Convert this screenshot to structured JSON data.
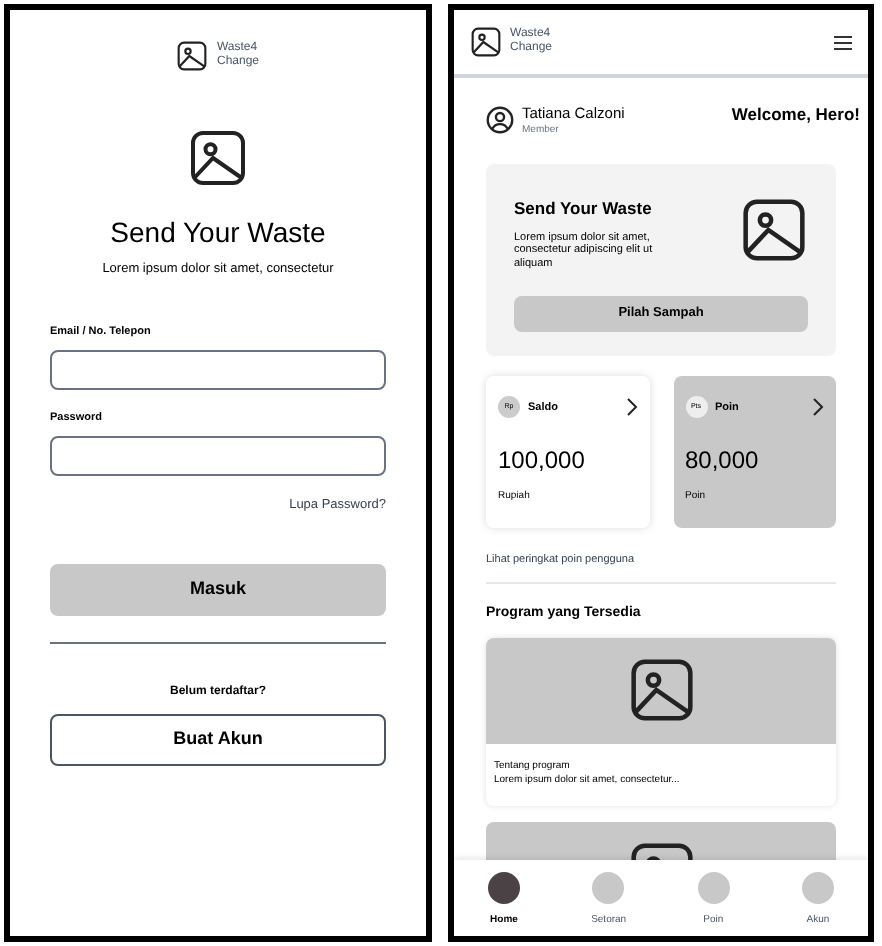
{
  "login": {
    "logo": [
      "Waste4",
      "Change"
    ],
    "title": "Send Your Waste",
    "subtitle": "Lorem ipsum dolor sit amet, consectetur",
    "fields": [
      {
        "label": "Email / No. Telepon"
      },
      {
        "label": "Password"
      }
    ],
    "forgot_link": "Lupa Password?",
    "login_button": "Masuk",
    "register_prompt": "Belum terdaftar?",
    "register_button": "Buat Akun"
  },
  "home": {
    "logo": [
      "Waste4",
      "Change"
    ],
    "user": {
      "name": "Tatiana Calzoni",
      "role": "Member"
    },
    "greeting": "Welcome, Hero!",
    "promo": {
      "title": "Send Your Waste",
      "text": "Lorem ipsum dolor sit amet, consectetur adipiscing elit ut aliquam",
      "button": "Pilah Sampah"
    },
    "balances": [
      {
        "badge": "Rp",
        "label": "Saldo",
        "value": "100,000",
        "unit": "Rupiah",
        "selected": false
      },
      {
        "badge": "Pts",
        "label": "Poin",
        "value": "80,000",
        "unit": "Poin",
        "selected": true
      }
    ],
    "ranking_link": "Lihat peringkat poin pengguna",
    "programs_heading": "Program yang Tersedia",
    "programs": [
      {
        "title": "Tentang program",
        "text": "Lorem ipsum dolor sit amet, consectetur..."
      },
      {
        "kind": "picture"
      }
    ],
    "nav": [
      {
        "label": "Home",
        "selected": true
      },
      {
        "label": "Setoran",
        "selected": false
      },
      {
        "label": "Poin",
        "selected": false
      },
      {
        "label": "Akun",
        "selected": false
      }
    ]
  }
}
